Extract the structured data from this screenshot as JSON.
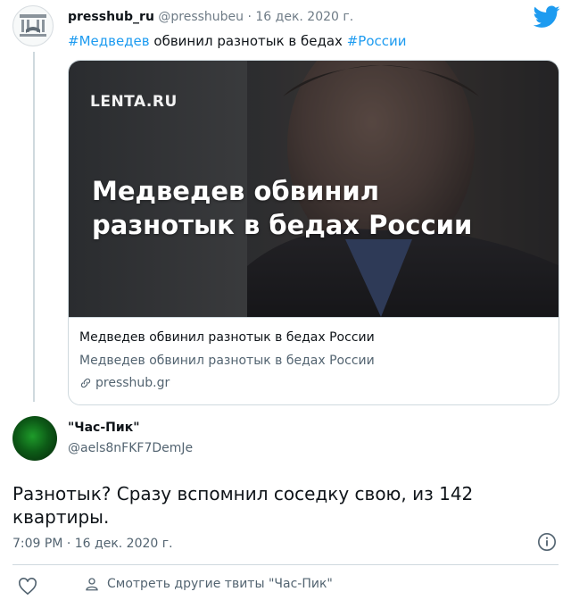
{
  "tweet": {
    "author_name": "presshub_ru",
    "author_handle": "@presshubeu",
    "separator": " · ",
    "date": "16 дек. 2020 г.",
    "text": {
      "hashtag1": "#Медведев",
      "middle": " обвинил разнотык в бедах ",
      "hashtag2": "#России"
    },
    "card": {
      "image_logo": "LENTA.RU",
      "image_headline": "Медведев обвинил разнотык в бедах России",
      "title": "Медведев обвинил разнотык в бедах России",
      "description": "Медведев обвинил разнотык в бедах России",
      "domain": "presshub.gr"
    }
  },
  "reply": {
    "author_name": "\"Час-Пик\"",
    "author_handle": "@aels8nFKF7DemJe",
    "text": "Разнотык? Сразу вспомнил соседку свою, из 142 квартиры.",
    "timestamp": "7:09 PM · 16 дек. 2020 г.",
    "more_tweets_label": "Смотреть другие твиты \"Час-Пик\""
  },
  "colors": {
    "accent": "#1d9bf0",
    "text": "#0f1419",
    "secondary": "#536471",
    "border": "#cfd9de"
  },
  "icons": [
    "twitter-logo-icon",
    "link-icon",
    "info-icon",
    "heart-icon",
    "person-icon"
  ]
}
